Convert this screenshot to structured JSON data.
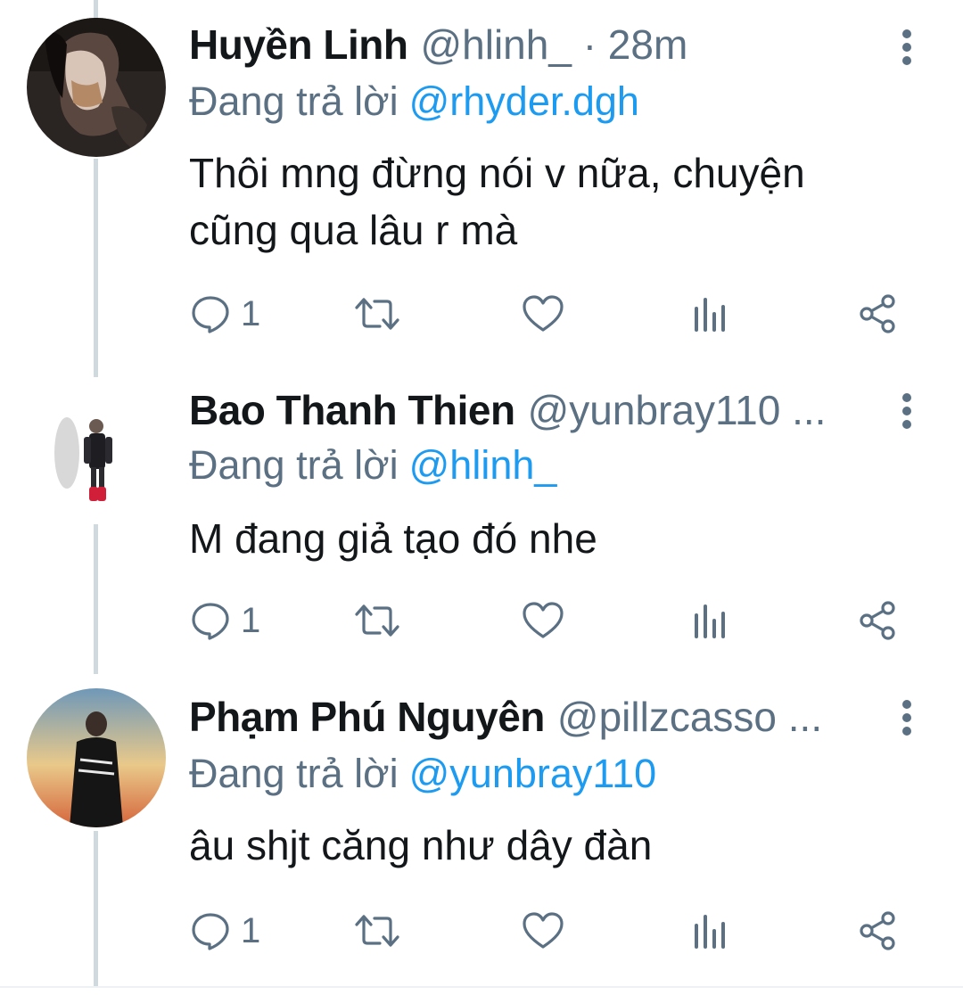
{
  "replies": [
    {
      "name": "Huyền Linh",
      "handle": "@hlinh_ · 28m",
      "reply_prefix": "Đang trả lời",
      "reply_to": "@rhyder.dgh",
      "text_lines": [
        "Thôi mng đừng nói v nữa, chuyện",
        "cũng qua lâu r mà"
      ],
      "reply_count": "1",
      "avatar_icon": "woman-photo-avatar"
    },
    {
      "name": "Bao Thanh Thien",
      "handle": "@yunbray110 ...",
      "reply_prefix": "Đang trả lời",
      "reply_to": "@hlinh_",
      "text_lines": [
        "M đang giả tạo đó nhe"
      ],
      "reply_count": "1",
      "avatar_icon": "standing-man-avatar"
    },
    {
      "name": "Phạm Phú Nguyên",
      "handle": "@pillzcasso ...",
      "reply_prefix": "Đang trả lời",
      "reply_to": "@yunbray110",
      "text_lines": [
        "âu shjt căng như dây đàn"
      ],
      "reply_count": "1",
      "avatar_icon": "man-gradient-avatar"
    }
  ],
  "icons": {
    "more": "more-vertical-icon",
    "reply": "comment-icon",
    "retweet": "retweet-icon",
    "like": "heart-icon",
    "analytics": "analytics-icon",
    "share": "share-icon"
  },
  "colors": {
    "link": "#1d9bf0",
    "secondary": "#5b7083",
    "text": "#14171a",
    "thread_line": "#cfd9de"
  }
}
